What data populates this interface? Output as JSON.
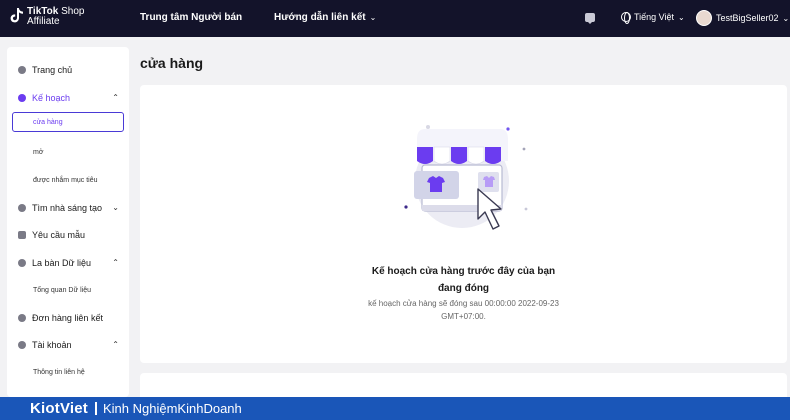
{
  "topbar": {
    "logo_line1_bold": "TikTok",
    "logo_line1_rest": " Shop",
    "logo_line2": "Affiliate",
    "nav": [
      "Trung tâm Người bán",
      "Hướng dẫn liên kết"
    ],
    "language": "Tiếng Việt",
    "username": "TestBigSeller02"
  },
  "sidebar": {
    "home": "Trang chủ",
    "plan": "Kế hoạch",
    "plan_sub": [
      "cửa hàng",
      "mở",
      "được nhắm mục tiêu"
    ],
    "creators": "Tìm nhà sáng tạo",
    "samples": "Yêu cầu mẫu",
    "data_compass": "La bàn Dữ liệu",
    "data_sub": [
      "Tổng quan Dữ liệu"
    ],
    "orders": "Đơn hàng liên kết",
    "account": "Tài khoản",
    "account_sub": [
      "Thông tin liên hệ"
    ]
  },
  "main": {
    "title": "cửa hàng",
    "message_line1": "Kế hoạch cửa hàng trước đây của bạn",
    "message_line2": "đang đóng",
    "note_line1": "kế hoạch cửa hàng sẽ đóng sau 00:00:00 2022-09-23",
    "note_line2": "GMT+07:00."
  },
  "footer": {
    "brand": "KiotViet",
    "tagline": "Kinh NghiệmKinhDoanh"
  },
  "colors": {
    "topbar": "#13132a",
    "accent": "#6b3cf0",
    "footer": "#1a56b8"
  }
}
